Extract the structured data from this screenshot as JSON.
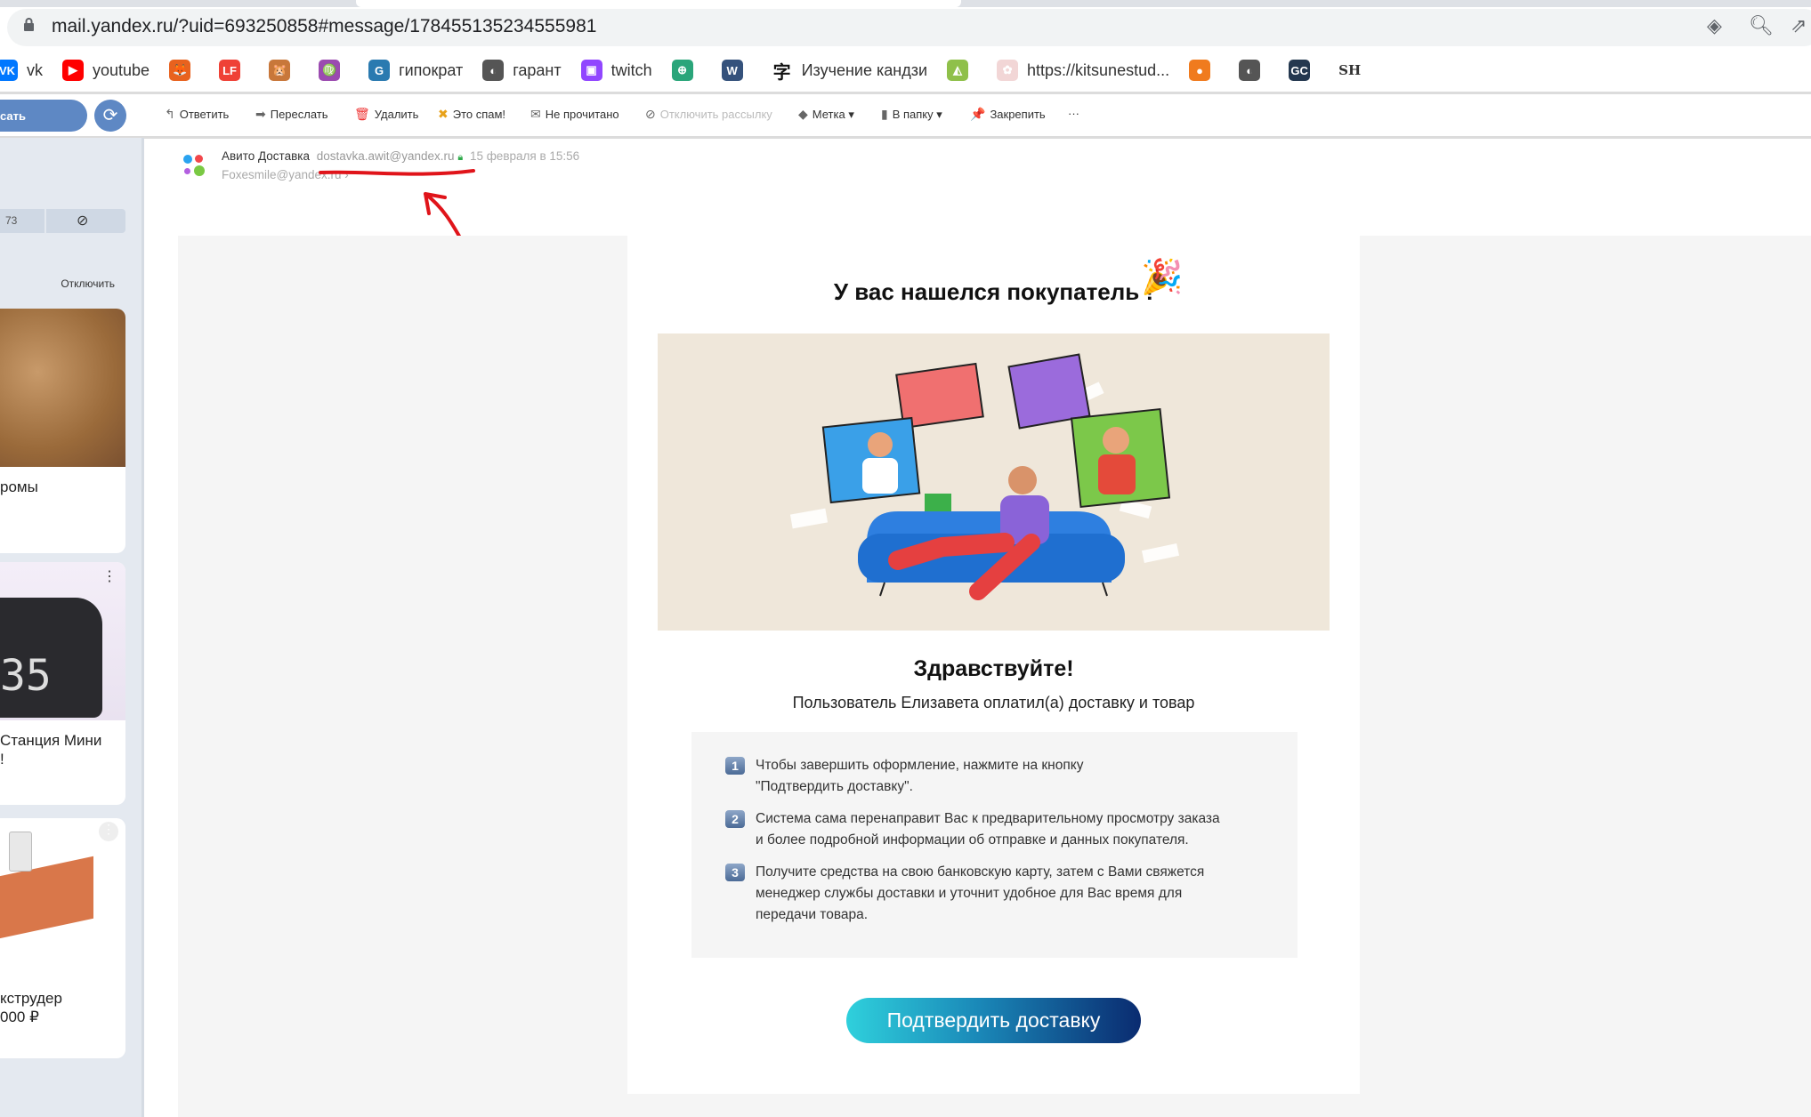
{
  "browser": {
    "url": "mail.yandex.ru/?uid=693250858#message/178455135234555981"
  },
  "bookmarks": [
    {
      "label": "vk",
      "color": "#0077ff",
      "glyph": "VK"
    },
    {
      "label": "youtube",
      "color": "#ff0000",
      "glyph": "▶"
    },
    {
      "label": "",
      "color": "#e8621e",
      "glyph": "🦊"
    },
    {
      "label": "",
      "color": "#ef4136",
      "glyph": "LF"
    },
    {
      "label": "",
      "color": "#c8773a",
      "glyph": "🐹"
    },
    {
      "label": "",
      "color": "#9b4bb0",
      "glyph": "♍"
    },
    {
      "label": "гипократ",
      "color": "#2a7ab0",
      "glyph": "G"
    },
    {
      "label": "гарант",
      "color": "#555555",
      "glyph": "◐"
    },
    {
      "label": "twitch",
      "color": "#9146ff",
      "glyph": "▣"
    },
    {
      "label": "",
      "color": "#2aa57a",
      "glyph": "⊕"
    },
    {
      "label": "",
      "color": "#35527c",
      "glyph": "W"
    },
    {
      "label": "Изучение кандзи",
      "color": "#ffffff",
      "glyph": "字"
    },
    {
      "label": "",
      "color": "#8fc04a",
      "glyph": "◭"
    },
    {
      "label": "https://kitsunestud...",
      "color": "#f2d6d6",
      "glyph": "✿"
    },
    {
      "label": "",
      "color": "#f07b1e",
      "glyph": "●"
    },
    {
      "label": "",
      "color": "#555555",
      "glyph": "◐"
    },
    {
      "label": "",
      "color": "#24384f",
      "glyph": "GC"
    },
    {
      "label": "SH",
      "color": "#ffffff",
      "glyph": ""
    }
  ],
  "toolbar": {
    "compose": "сать",
    "items": [
      {
        "label": "Ответить",
        "icon": "reply-icon",
        "glyph": "↰"
      },
      {
        "label": "Переслать",
        "icon": "forward-icon",
        "glyph": "➡"
      },
      {
        "label": "Удалить",
        "icon": "trash-icon",
        "glyph": "🗑"
      },
      {
        "label": "Это спам!",
        "icon": "spam-icon",
        "glyph": "✖"
      },
      {
        "label": "Не прочитано",
        "icon": "envelope-icon",
        "glyph": "✉"
      },
      {
        "label": "Отключить рассылку",
        "icon": "unsubscribe-icon",
        "glyph": "⊘"
      },
      {
        "label": "Метка ▾",
        "icon": "tag-icon",
        "glyph": "◆"
      },
      {
        "label": "В папку ▾",
        "icon": "folder-icon",
        "glyph": "▮"
      },
      {
        "label": "Закрепить",
        "icon": "pin-icon",
        "glyph": "📌"
      },
      {
        "label": "···",
        "icon": "more-icon",
        "glyph": ""
      }
    ]
  },
  "sidebar": {
    "counter": "73",
    "disable": "Отключить",
    "ads": [
      {
        "text": "ромы"
      },
      {
        "text": "Станция Мини\n!"
      },
      {
        "text": "кструдер\n 000 ₽"
      }
    ]
  },
  "message": {
    "sender_name": "Авито Доставка",
    "sender_email": "dostavka.awit@yandex.ru",
    "date": "15 февраля в 15:56",
    "recipient": "Foxesmile@yandex.ru ›",
    "title": "У вас нашелся покупатель !",
    "greeting": "Здравствуйте!",
    "subtitle": "Пользователь Елизавета оплатил(а) доставку и товар",
    "steps": [
      {
        "n": "1",
        "lines": [
          "Чтобы завершить оформление, нажмите на кнопку",
          "\"Подтвердить доставку\"."
        ]
      },
      {
        "n": "2",
        "lines": [
          "Система сама перенаправит Вас к предварительному просмотру заказа",
          "и более подробной информации об отправке и данных покупателя."
        ]
      },
      {
        "n": "3",
        "lines": [
          "Получите средства на свою банковскую карту, затем с Вами свяжется",
          "менеджер службы доставки и уточнит удобное для Вас время для",
          "передачи товара."
        ]
      }
    ],
    "button": "Подтвердить доставку"
  }
}
